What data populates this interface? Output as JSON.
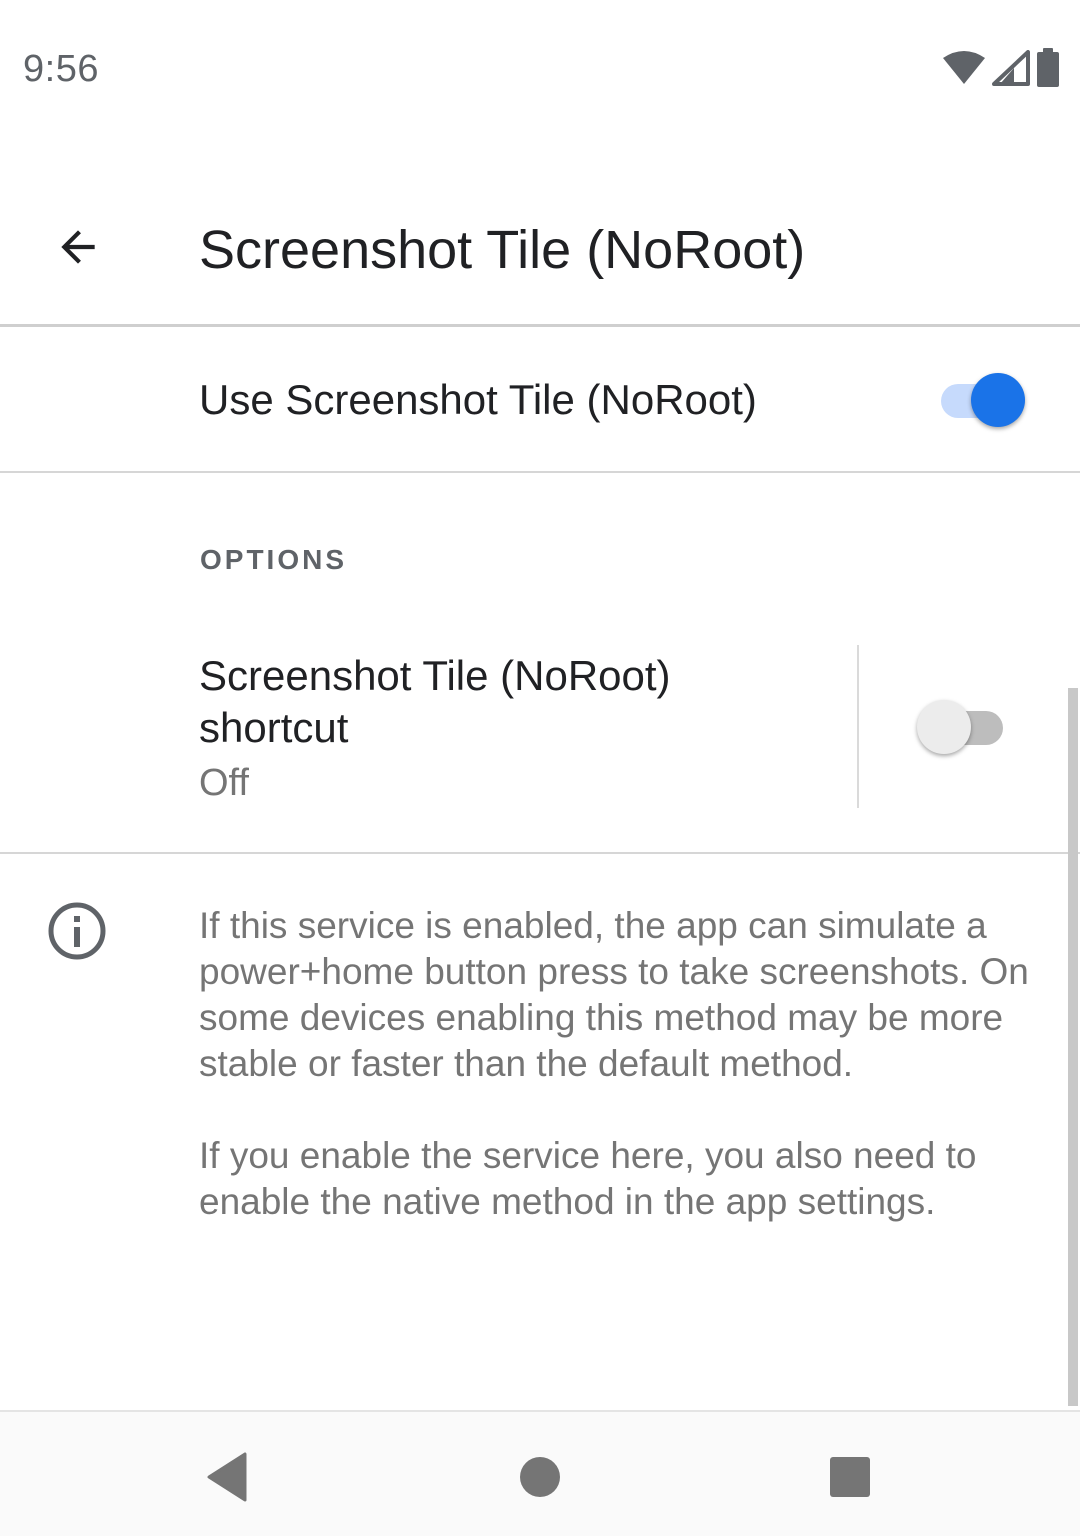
{
  "status_bar": {
    "time": "9:56"
  },
  "app_bar": {
    "title": "Screenshot Tile (NoRoot)",
    "back_icon": "arrow-back-icon"
  },
  "master_switch": {
    "label": "Use Screenshot Tile (NoRoot)",
    "checked": true
  },
  "options": {
    "header": "OPTIONS",
    "shortcut": {
      "title": "Screenshot Tile (NoRoot) shortcut",
      "summary": "Off",
      "checked": false
    }
  },
  "info": {
    "icon": "info-icon",
    "paragraph_1": "If this service is enabled, the app can simulate a power+home button press to take screenshots. On some devices enabling this method may be more stable or faster than the default method.",
    "paragraph_2": "If you enable the service here, you also need to enable the native method in the app settings."
  },
  "nav_bar": {
    "back_icon": "nav-back-icon",
    "home_icon": "nav-home-icon",
    "recents_icon": "nav-recents-icon"
  },
  "colors": {
    "accent": "#1a73e8",
    "accent_track": "#c6dafc",
    "switch_off_thumb": "#ececec",
    "switch_off_track": "#bdbdbd",
    "text_primary": "#202124",
    "text_secondary": "#757575"
  }
}
